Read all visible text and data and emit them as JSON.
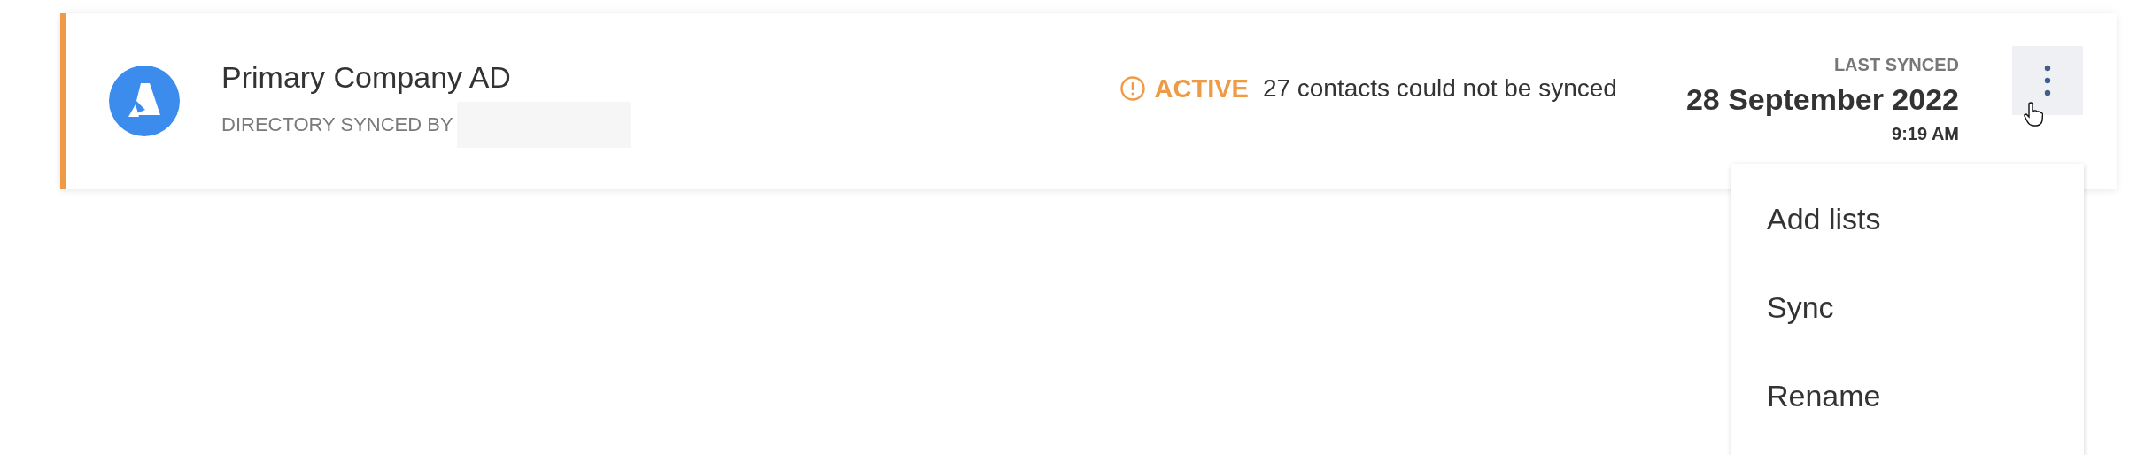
{
  "directory": {
    "name": "Primary Company AD",
    "synced_by_label": "DIRECTORY SYNCED BY",
    "status": {
      "kind": "warning",
      "label": "ACTIVE",
      "message": "27 contacts could not be synced"
    },
    "last_synced": {
      "label": "LAST SYNCED",
      "date": "28 September 2022",
      "time": "9:19 AM"
    },
    "menu": {
      "open": true,
      "items": [
        {
          "label": "Add lists"
        },
        {
          "label": "Sync"
        },
        {
          "label": "Rename"
        }
      ]
    }
  }
}
